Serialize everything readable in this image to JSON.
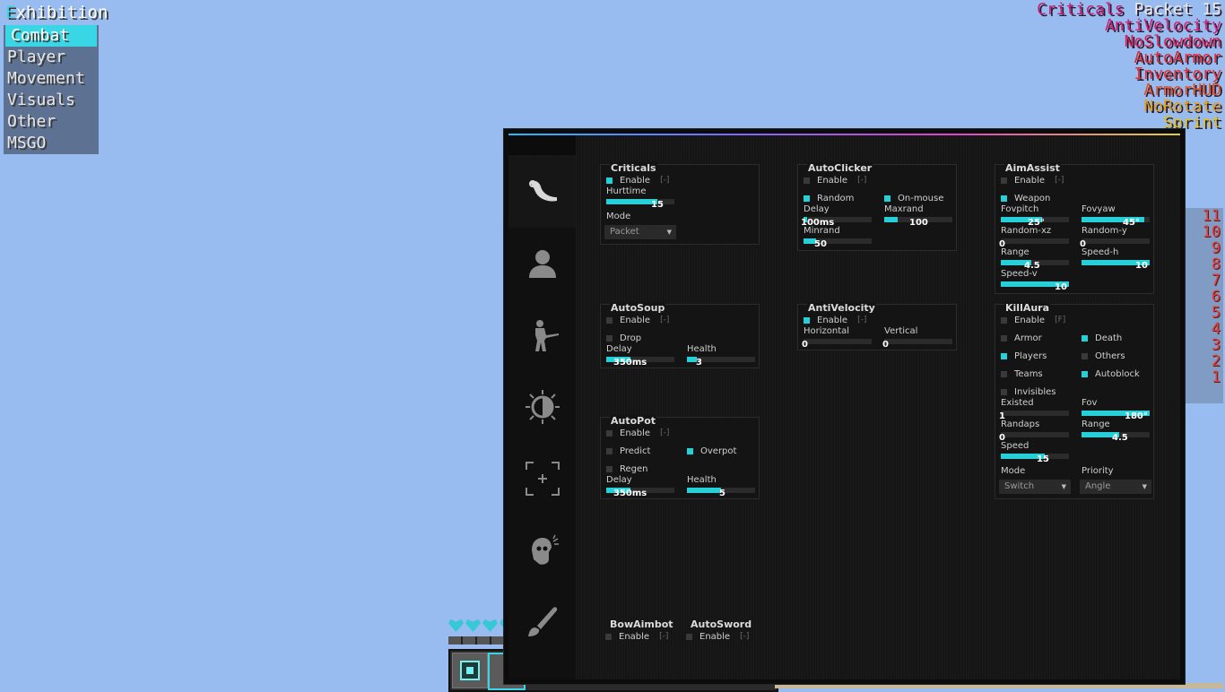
{
  "client": {
    "title_first": "E",
    "title_rest": "xhibition",
    "tabs": [
      "Combat",
      "Player",
      "Movement",
      "Visuals",
      "Other",
      "MSGO"
    ],
    "active_tab": "Combat"
  },
  "arraylist": [
    {
      "name": "Criticals",
      "suffix": " Packet 15",
      "color": "#c0207a"
    },
    {
      "name": "AntiVelocity",
      "suffix": "",
      "color": "#d0207a"
    },
    {
      "name": "NoSlowdown",
      "suffix": "",
      "color": "#d8205a"
    },
    {
      "name": "AutoArmor",
      "suffix": "",
      "color": "#dc2a3a"
    },
    {
      "name": "Inventory",
      "suffix": "",
      "color": "#e0303a"
    },
    {
      "name": "ArmorHUD",
      "suffix": "",
      "color": "#e0502a"
    },
    {
      "name": "NoRotate",
      "suffix": "",
      "color": "#e0a020"
    },
    {
      "name": "Sprint",
      "suffix": "",
      "color": "#e0c020"
    }
  ],
  "number_strip": [
    "11",
    "10",
    "9",
    "8",
    "7",
    "6",
    "5",
    "4",
    "3",
    "2",
    "1"
  ],
  "accent": "#27cfd9",
  "sidebar_icons": [
    "knife-icon",
    "user-icon",
    "soldier-icon",
    "brightness-icon",
    "crosshair-icon",
    "head-icon",
    "brush-icon"
  ],
  "modules": {
    "criticals": {
      "title": "Criticals",
      "enable": "Enable",
      "bind": "[-]",
      "hurttime_label": "Hurttime",
      "hurttime": 15,
      "hurttime_fraction": 0.75,
      "mode_label": "Mode",
      "mode_value": "Packet"
    },
    "autoclicker": {
      "title": "AutoClicker",
      "enable": "Enable",
      "bind": "[-]",
      "random": "Random",
      "onmouse": "On-mouse",
      "delay_label": "Delay",
      "delay": "100ms",
      "delay_fraction": 0.05,
      "maxrand_label": "Maxrand",
      "maxrand": "100",
      "maxrand_fraction": 0.2,
      "minrand_label": "Minrand",
      "minrand": "50",
      "minrand_fraction": 0.18
    },
    "aimassist": {
      "title": "AimAssist",
      "enable": "Enable",
      "bind": "[-]",
      "weapon": "Weapon",
      "fovpitch_label": "Fovpitch",
      "fovpitch": "25°",
      "fovpitch_fraction": 0.6,
      "fovyaw_label": "Fovyaw",
      "fovyaw": "45°",
      "fovyaw_fraction": 0.92,
      "randomxz_label": "Random-xz",
      "randomxz": "0",
      "randomy_label": "Random-y",
      "randomy": "0",
      "range_label": "Range",
      "range": "4.5",
      "range_fraction": 0.45,
      "speedh_label": "Speed-h",
      "speedh": "10",
      "speedh_fraction": 1.0,
      "speedv_label": "Speed-v",
      "speedv": "10",
      "speedv_fraction": 1.0
    },
    "autosoup": {
      "title": "AutoSoup",
      "enable": "Enable",
      "bind": "[-]",
      "drop": "Drop",
      "delay_label": "Delay",
      "delay": "350ms",
      "delay_fraction": 0.35,
      "health_label": "Health",
      "health": "3",
      "health_fraction": 0.15
    },
    "antivelocity": {
      "title": "AntiVelocity",
      "enable": "Enable",
      "bind": "[-]",
      "horizontal_label": "Horizontal",
      "horizontal": "0",
      "vertical_label": "Vertical",
      "vertical": "0"
    },
    "killaura": {
      "title": "KillAura",
      "enable": "Enable",
      "bind": "[F]",
      "armor": "Armor",
      "death": "Death",
      "players": "Players",
      "others": "Others",
      "teams": "Teams",
      "autoblock": "Autoblock",
      "invisibles": "Invisibles",
      "existed_label": "Existed",
      "existed": "1",
      "fov_label": "Fov",
      "fov": "180°",
      "fov_fraction": 1.0,
      "randaps_label": "Randaps",
      "randaps": "0",
      "range_label": "Range",
      "range": "4.5",
      "range_fraction": 0.55,
      "speed_label": "Speed",
      "speed": "15",
      "speed_fraction": 0.65,
      "mode_label": "Mode",
      "mode_value": "Switch",
      "priority_label": "Priority",
      "priority_value": "Angle"
    },
    "autopot": {
      "title": "AutoPot",
      "enable": "Enable",
      "bind": "[-]",
      "predict": "Predict",
      "overpot": "Overpot",
      "regen": "Regen",
      "delay_label": "Delay",
      "delay": "350ms",
      "delay_fraction": 0.35,
      "health_label": "Health",
      "health": "5",
      "health_fraction": 0.5
    },
    "bowaimbot": {
      "title": "BowAimbot",
      "enable": "Enable",
      "bind": "[-]"
    },
    "autosword": {
      "title": "AutoSword",
      "enable": "Enable",
      "bind": "[-]"
    }
  }
}
